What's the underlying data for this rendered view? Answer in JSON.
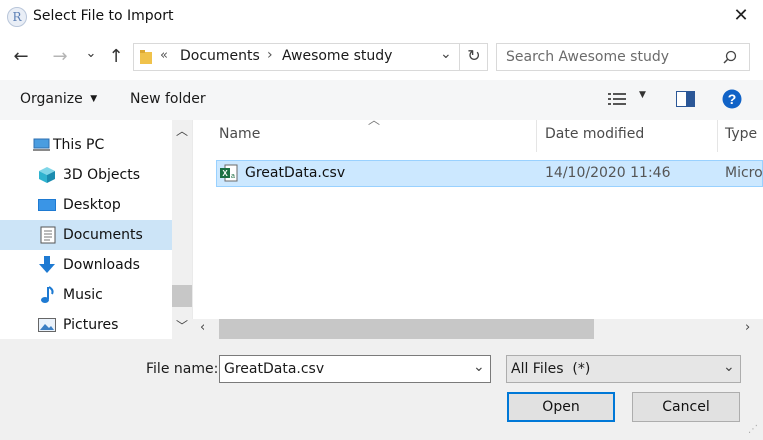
{
  "window": {
    "title": "Select File to Import",
    "app_icon_glyph": "R",
    "close_glyph": "✕"
  },
  "nav": {
    "back_glyph": "←",
    "forward_glyph": "→",
    "recent_glyph": "⌄",
    "up_glyph": "↑",
    "breadcrumb_overflow": "«",
    "breadcrumb": [
      "Documents",
      "Awesome study"
    ],
    "breadcrumb_separator": "›",
    "refresh_glyph": "↻",
    "search_placeholder": "Search Awesome study"
  },
  "toolbar": {
    "organize_label": "Organize",
    "new_folder_label": "New folder"
  },
  "sidebar": {
    "items": [
      {
        "label": "This PC",
        "icon": "pc-icon",
        "selected": false
      },
      {
        "label": "3D Objects",
        "icon": "cube-icon",
        "selected": false
      },
      {
        "label": "Desktop",
        "icon": "desktop-icon",
        "selected": false
      },
      {
        "label": "Documents",
        "icon": "document-icon",
        "selected": true
      },
      {
        "label": "Downloads",
        "icon": "download-arrow-icon",
        "selected": false
      },
      {
        "label": "Music",
        "icon": "music-note-icon",
        "selected": false
      },
      {
        "label": "Pictures",
        "icon": "picture-icon",
        "selected": false
      }
    ]
  },
  "file_list": {
    "columns": [
      "Name",
      "Date modified",
      "Type"
    ],
    "files": [
      {
        "name": "GreatData.csv",
        "date_modified": "14/10/2020 11:46",
        "type": "Micro",
        "selected": true
      }
    ]
  },
  "bottom": {
    "file_name_label": "File name:",
    "file_name_value": "GreatData.csv",
    "file_type_value": "All Files  (*)",
    "open_label": "Open",
    "cancel_label": "Cancel"
  },
  "colors": {
    "selection": "#cce8ff",
    "sidebar_selection": "#cce4f7",
    "accent": "#0078d7"
  }
}
